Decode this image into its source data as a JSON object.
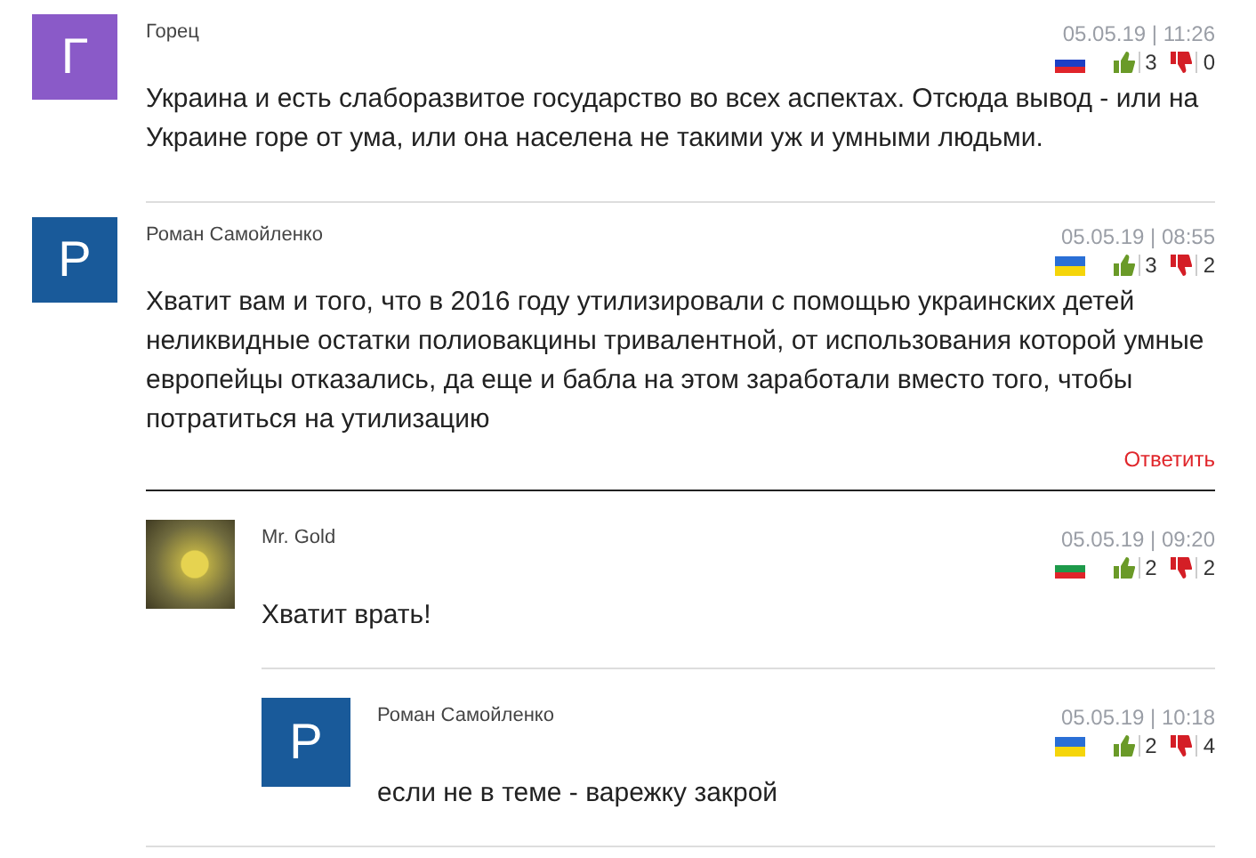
{
  "comments": [
    {
      "author": "Горец",
      "avatar": {
        "kind": "letter",
        "letter": "Г",
        "color": "#8a5ac8"
      },
      "date": "05.05.19 | 11:26",
      "flag": {
        "kind": "ru"
      },
      "likes": "3",
      "dislikes": "0",
      "text": "Украина и есть слаборазвитое государство во всех аспектах. Отсюда вывод - или на Украине горе от ума, или она населена не такими уж и умными людьми."
    },
    {
      "author": "Роман Самойленко",
      "avatar": {
        "kind": "letter",
        "letter": "Р",
        "color": "#195a9a"
      },
      "date": "05.05.19 | 08:55",
      "flag": {
        "kind": "ua"
      },
      "likes": "3",
      "dislikes": "2",
      "text": "Хватит вам и того, что в 2016 году утилизировали с помощью украинских детей неликвидные остатки полиовакцины тривалентной, от использования которой умные европейцы отказались, да еще и бабла на этом заработали вместо того, чтобы потратиться на утилизацию",
      "reply": "Ответить",
      "children": [
        {
          "author": "Mr. Gold",
          "avatar": {
            "kind": "photo"
          },
          "date": "05.05.19 | 09:20",
          "flag": {
            "kind": "bg"
          },
          "likes": "2",
          "dislikes": "2",
          "text": "Хватит врать!",
          "children": [
            {
              "author": "Роман Самойленко",
              "avatar": {
                "kind": "letter",
                "letter": "Р",
                "color": "#195a9a"
              },
              "date": "05.05.19 | 10:18",
              "flag": {
                "kind": "ua"
              },
              "likes": "2",
              "dislikes": "4",
              "text": "если не в теме - варежку закрой"
            }
          ]
        }
      ]
    }
  ]
}
